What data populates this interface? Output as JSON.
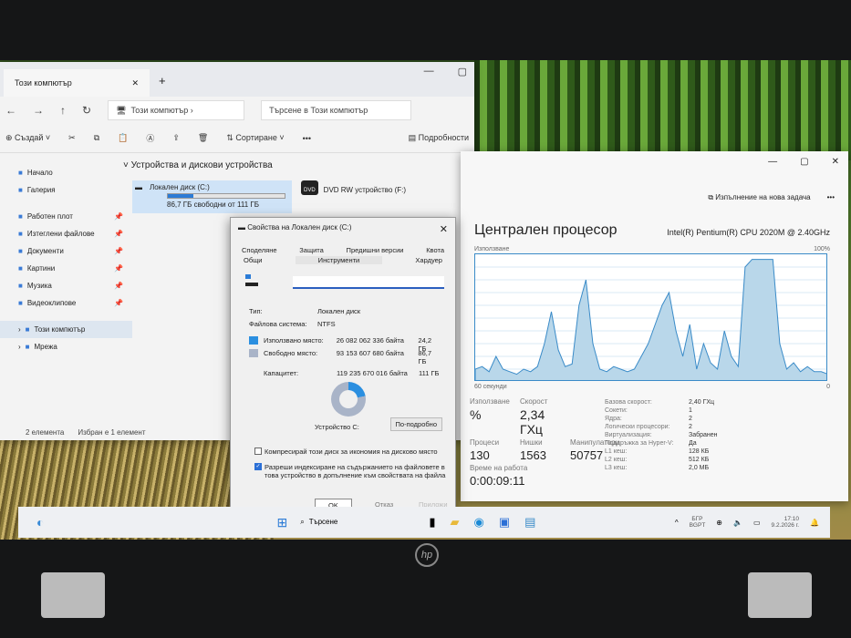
{
  "explorer": {
    "tab_title": "Този компютър",
    "address": "Този компютър",
    "search_placeholder": "Търсене в Този компютър",
    "toolbar": {
      "new": "Създай",
      "sort": "Сортиране",
      "more": "•••",
      "details": "Подробности"
    },
    "sidebar": [
      {
        "label": "Начало",
        "pinned": false
      },
      {
        "label": "Галерия",
        "pinned": false
      },
      {
        "label": "Работен плот",
        "pinned": true
      },
      {
        "label": "Изтеглени файлове",
        "pinned": true
      },
      {
        "label": "Документи",
        "pinned": true
      },
      {
        "label": "Картини",
        "pinned": true
      },
      {
        "label": "Музика",
        "pinned": true
      },
      {
        "label": "Видеоклипове",
        "pinned": true
      },
      {
        "label": "Този компютър",
        "pinned": false
      },
      {
        "label": "Мрежа",
        "pinned": false
      }
    ],
    "section": "Устройства и дискови устройства",
    "drives": [
      {
        "name": "Локален диск (C:)",
        "free": "86,7 ГБ свободни от 111 ГБ",
        "used_percent": 22
      },
      {
        "name": "DVD RW устройство (F:)",
        "badge": "DVD"
      }
    ],
    "status": {
      "count": "2 елемента",
      "selected": "Избран е 1 елемент"
    }
  },
  "dialog": {
    "title": "Свойства на Локален диск (C:)",
    "tabs_row1": [
      "Споделяне",
      "Защита",
      "Предишни версии",
      "Квота"
    ],
    "tabs_row2": [
      "Общи",
      "Инструменти",
      "Хардуер"
    ],
    "type_label": "Тип:",
    "type_value": "Локален диск",
    "fs_label": "Файлова система:",
    "fs_value": "NTFS",
    "used_label": "Използвано място:",
    "used_bytes": "26 082 062 336 байта",
    "used_gb": "24,2 ГБ",
    "free_label": "Свободно място:",
    "free_bytes": "93 153 607 680 байта",
    "free_gb": "86,7 ГБ",
    "capacity_label": "Капацитет:",
    "capacity_bytes": "119 235 670 016 байта",
    "capacity_gb": "111 ГБ",
    "drive_label": "Устройство C:",
    "details_button": "По-подробно",
    "compress_label": "Компресирай този диск за икономия на дисково място",
    "compress_checked": false,
    "index_label": "Разреши индексиране на съдържанието на файловете в това устройство в допълнение към свойствата на файла",
    "index_checked": true,
    "ok": "OK",
    "cancel": "Отказ",
    "apply": "Приложи",
    "used_fraction": 0.22,
    "colors": {
      "used": "#2b8fe0",
      "free": "#a9b4c8"
    }
  },
  "taskmgr": {
    "new_task": "Изпълнение на нова задача",
    "title": "Централен процесор",
    "cpu_name": "Intel(R) Pentium(R) CPU 2020M @ 2.40GHz",
    "graph_label": "Използване",
    "graph_max": "100%",
    "graph_min": "0",
    "graph_time": "60 секунди",
    "cpu_history": [
      10,
      12,
      8,
      20,
      10,
      8,
      6,
      10,
      8,
      12,
      30,
      55,
      25,
      12,
      14,
      60,
      80,
      30,
      10,
      8,
      12,
      10,
      8,
      10,
      20,
      30,
      45,
      60,
      70,
      40,
      20,
      45,
      10,
      30,
      15,
      10,
      40,
      20,
      12,
      90,
      96,
      96,
      96,
      96,
      30,
      10,
      15,
      8,
      12,
      8,
      8,
      6
    ],
    "stats": {
      "utilization_label": "Използване",
      "utilization": "%",
      "speed_label": "Скорост",
      "speed": "2,34 ГХц",
      "processes_label": "Процеси",
      "processes": "130",
      "threads_label": "Нишки",
      "threads": "1563",
      "handles_label": "Манипулатори",
      "handles": "50757",
      "uptime_label": "Време на работа",
      "uptime": "0:00:09:11"
    },
    "specs": [
      [
        "Базова скорост:",
        "2,40 ГХц"
      ],
      [
        "Сокети:",
        "1"
      ],
      [
        "Ядра:",
        "2"
      ],
      [
        "Логически процесори:",
        "2"
      ],
      [
        "Виртуализация:",
        "Забранен"
      ],
      [
        "Поддръжка за Hyper-V:",
        "Да"
      ],
      [
        "L1 кеш:",
        "128 КБ"
      ],
      [
        "L2 кеш:",
        "512 КБ"
      ],
      [
        "L3 кеш:",
        "2,0 МБ"
      ]
    ]
  },
  "taskbar": {
    "search": "Търсене",
    "lang1": "БГР",
    "lang2": "BGPT",
    "time": "17:10",
    "date": "9.2.2026 г."
  },
  "laptop": {
    "brand": "hp"
  }
}
